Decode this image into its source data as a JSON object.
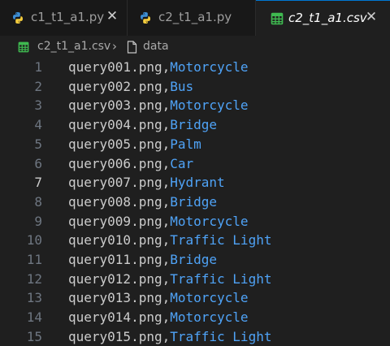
{
  "tabs": [
    {
      "label": "c1_t1_a1.py",
      "icon": "python-icon",
      "active": false,
      "closable": true
    },
    {
      "label": "c2_t1_a1.py",
      "icon": "python-icon",
      "active": false,
      "closable": false
    },
    {
      "label": "c2_t1_a1.csv",
      "icon": "csv-table-icon",
      "active": true,
      "closable": true
    }
  ],
  "close_glyph": "✕",
  "breadcrumb": {
    "file": "c2_t1_a1.csv",
    "separator": "›",
    "item": "data"
  },
  "editor": {
    "current_line": 7,
    "lines": [
      {
        "num": "1",
        "prefix": "query001.png,",
        "label": "Motorcycle"
      },
      {
        "num": "2",
        "prefix": "query002.png,",
        "label": "Bus"
      },
      {
        "num": "3",
        "prefix": "query003.png,",
        "label": "Motorcycle"
      },
      {
        "num": "4",
        "prefix": "query004.png,",
        "label": "Bridge"
      },
      {
        "num": "5",
        "prefix": "query005.png,",
        "label": "Palm"
      },
      {
        "num": "6",
        "prefix": "query006.png,",
        "label": "Car"
      },
      {
        "num": "7",
        "prefix": "query007.png,",
        "label": "Hydrant"
      },
      {
        "num": "8",
        "prefix": "query008.png,",
        "label": "Bridge"
      },
      {
        "num": "9",
        "prefix": "query009.png,",
        "label": "Motorcycle"
      },
      {
        "num": "10",
        "prefix": "query010.png,",
        "label": "Traffic Light"
      },
      {
        "num": "11",
        "prefix": "query011.png,",
        "label": "Bridge"
      },
      {
        "num": "12",
        "prefix": "query012.png,",
        "label": "Traffic Light"
      },
      {
        "num": "13",
        "prefix": "query013.png,",
        "label": "Motorcycle"
      },
      {
        "num": "14",
        "prefix": "query014.png,",
        "label": "Motorcycle"
      },
      {
        "num": "15",
        "prefix": "query015.png,",
        "label": "Traffic Light"
      }
    ]
  },
  "colors": {
    "accent": "#0078d4",
    "csv_label": "#4fa3f7",
    "python_blue": "#3d8fd6",
    "python_yellow": "#f5cd3d",
    "csv_green": "#3fb950"
  }
}
